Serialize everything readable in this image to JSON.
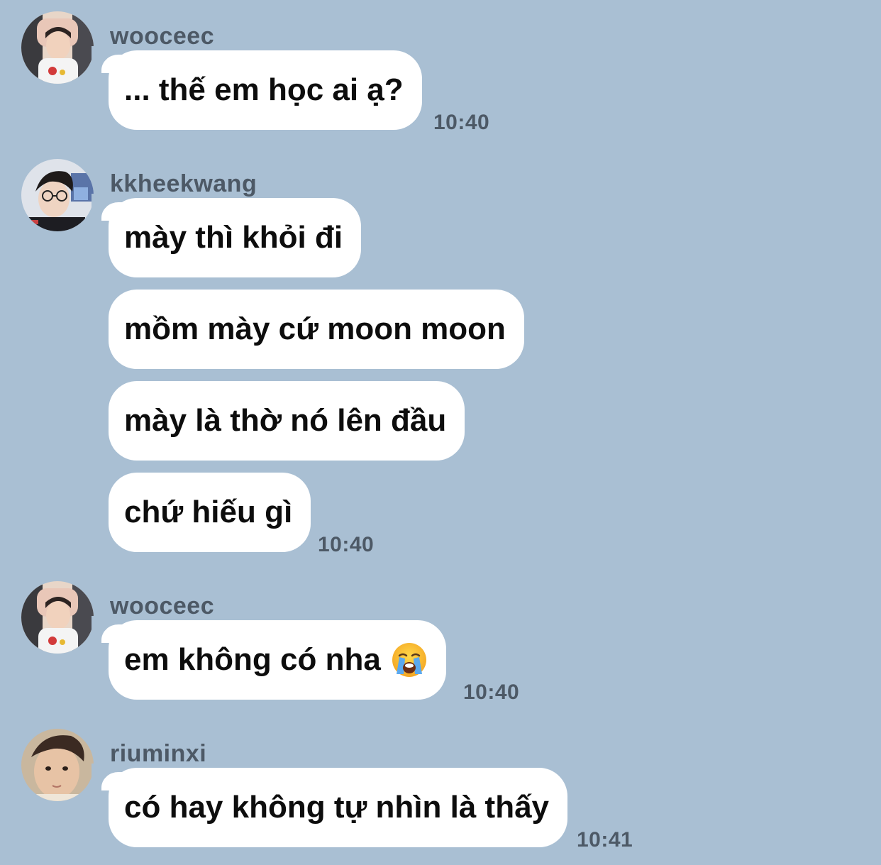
{
  "messages": [
    {
      "sender": "wooceec",
      "avatar": "avatar-wooceec",
      "bubbles": [
        "... thế em học ai ạ?"
      ],
      "time": "10:40"
    },
    {
      "sender": "kkheekwang",
      "avatar": "avatar-kkheekwang",
      "bubbles": [
        "mày thì khỏi đi",
        "mồm mày cứ moon moon",
        "mày là thờ nó lên đầu",
        "chứ hiếu gì"
      ],
      "time": "10:40"
    },
    {
      "sender": "wooceec",
      "avatar": "avatar-wooceec",
      "bubbles": [
        "em không có nha"
      ],
      "emoji": "loudly-crying-face-emoji",
      "time": "10:40"
    },
    {
      "sender": "riuminxi",
      "avatar": "avatar-riuminxi",
      "bubbles": [
        "có hay không tự nhìn là thấy"
      ],
      "time": "10:41"
    }
  ],
  "colors": {
    "background": "#a9bfd3",
    "bubble": "#ffffff",
    "meta_text": "#4d5966",
    "message_text": "#0d0d0d"
  }
}
